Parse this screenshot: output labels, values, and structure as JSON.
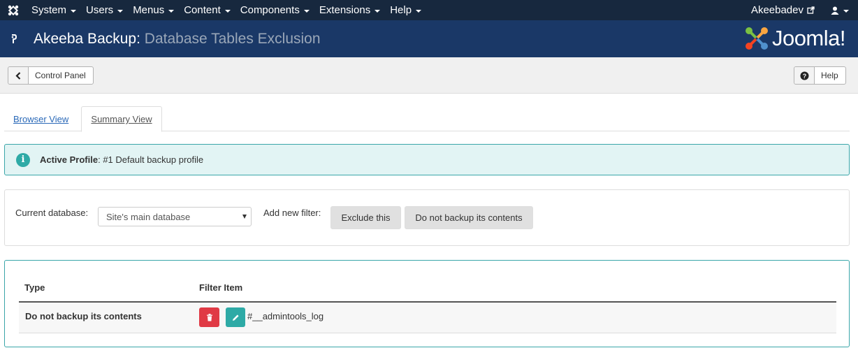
{
  "topmenu": {
    "items": [
      "System",
      "Users",
      "Menus",
      "Content",
      "Components",
      "Extensions",
      "Help"
    ],
    "user_site": "Akeebadev"
  },
  "header": {
    "title_prefix": "Akeeba Backup:",
    "title_sub": "Database Tables Exclusion",
    "brand": "Joomla!"
  },
  "toolbar": {
    "back_label": "Control Panel",
    "help_label": "Help"
  },
  "tabs": [
    {
      "label": "Browser View"
    },
    {
      "label": "Summary View"
    }
  ],
  "alert": {
    "label": "Active Profile",
    "value": ": #1 Default backup profile"
  },
  "filter": {
    "db_label": "Current database:",
    "db_selected": "Site's main database",
    "add_label": "Add new filter:",
    "exclude_label": "Exclude this",
    "nobackup_label": "Do not backup its contents"
  },
  "table": {
    "headers": [
      "Type",
      "Filter Item"
    ],
    "rows": [
      {
        "type": "Do not backup its contents",
        "item": "#__admintools_log"
      }
    ]
  },
  "colors": {
    "topbar": "#17283e",
    "titlebar": "#1a3867",
    "accent": "#2eaaa6",
    "danger": "#e03a45"
  }
}
